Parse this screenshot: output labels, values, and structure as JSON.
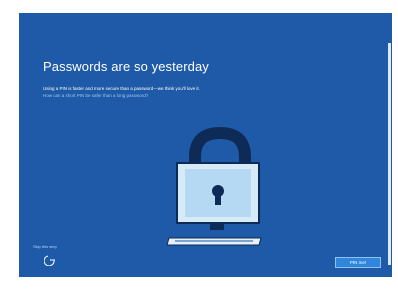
{
  "page": {
    "title": "Passwords are so yesterday",
    "description": "Using a PIN is faster and more secure than a password—we think you'll love it.",
    "help_link": "How can a short PIN be safer than a long password?"
  },
  "footer": {
    "skip_label": "Skip this step",
    "accessibility_icon": "ease-of-access-icon",
    "primary_button": "PIN me!"
  },
  "illustration": {
    "icon": "padlock-on-monitor-illustration"
  },
  "colors": {
    "background": "#1f5aa8",
    "button": "#2f86dc",
    "link": "#9cc8f2"
  }
}
